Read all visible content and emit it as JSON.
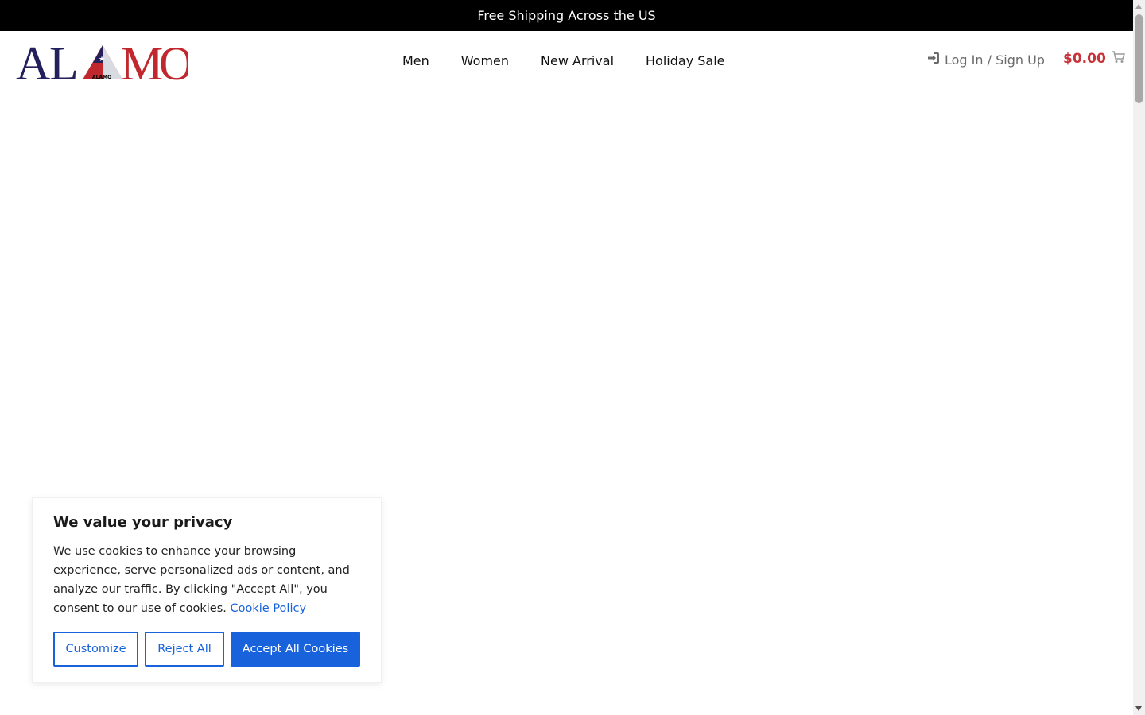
{
  "announcement": {
    "text": "Free Shipping Across the US"
  },
  "header": {
    "logo": {
      "letters": [
        "A",
        "L",
        "A",
        "M",
        "O"
      ],
      "small_text": "ALAMO",
      "colors": {
        "navy": "#23205c",
        "red": "#c0282e"
      }
    },
    "nav": [
      {
        "label": "Men"
      },
      {
        "label": "Women"
      },
      {
        "label": "New Arrival"
      },
      {
        "label": "Holiday Sale"
      }
    ],
    "account": {
      "label": "Log In / Sign Up",
      "icon": "sign-in-icon"
    },
    "cart": {
      "total": "$0.00",
      "icon": "cart-icon"
    }
  },
  "cookie_banner": {
    "title": "We value your privacy",
    "body": "We use cookies to enhance your browsing experience, serve personalized ads or content, and analyze our traffic. By clicking \"Accept All\", you consent to our use of cookies.",
    "policy_link": "Cookie Policy",
    "buttons": {
      "customize": "Customize",
      "reject": "Reject All",
      "accept": "Accept All Cookies"
    },
    "accent_color": "#1863dc"
  }
}
